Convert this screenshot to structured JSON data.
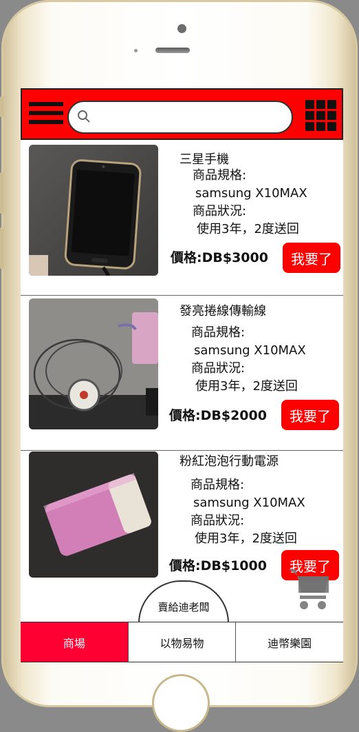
{
  "header": {
    "search_placeholder": ""
  },
  "products": [
    {
      "name": "三星手機",
      "spec_label": "商品規格:",
      "spec_value": "samsung X10MAX",
      "condition_label": "商品狀況:",
      "condition_value": "使用3年，2度送回",
      "price": "價格:DB$3000",
      "buy_label": "我要了"
    },
    {
      "name": "發亮捲線傳輸線",
      "spec_label": "商品規格:",
      "spec_value": "samsung X10MAX",
      "condition_label": "商品狀況:",
      "condition_value": "使用3年，2度送回",
      "price": "價格:DB$2000",
      "buy_label": "我要了"
    },
    {
      "name": "粉紅泡泡行動電源",
      "spec_label": "商品規格:",
      "spec_value": "samsung X10MAX",
      "condition_label": "商品狀況:",
      "condition_value": "使用3年，2度送回",
      "price": "價格:DB$1000",
      "buy_label": "我要了"
    }
  ],
  "sell_tab": "賣給迪老闆",
  "bottom_nav": [
    "商場",
    "以物易物",
    "迪幣樂園"
  ],
  "colors": {
    "accent": "#ff0000",
    "active_tab": "#ff0033"
  },
  "icons": [
    "menu-icon",
    "search-icon",
    "grid-icon",
    "cart-icon"
  ]
}
